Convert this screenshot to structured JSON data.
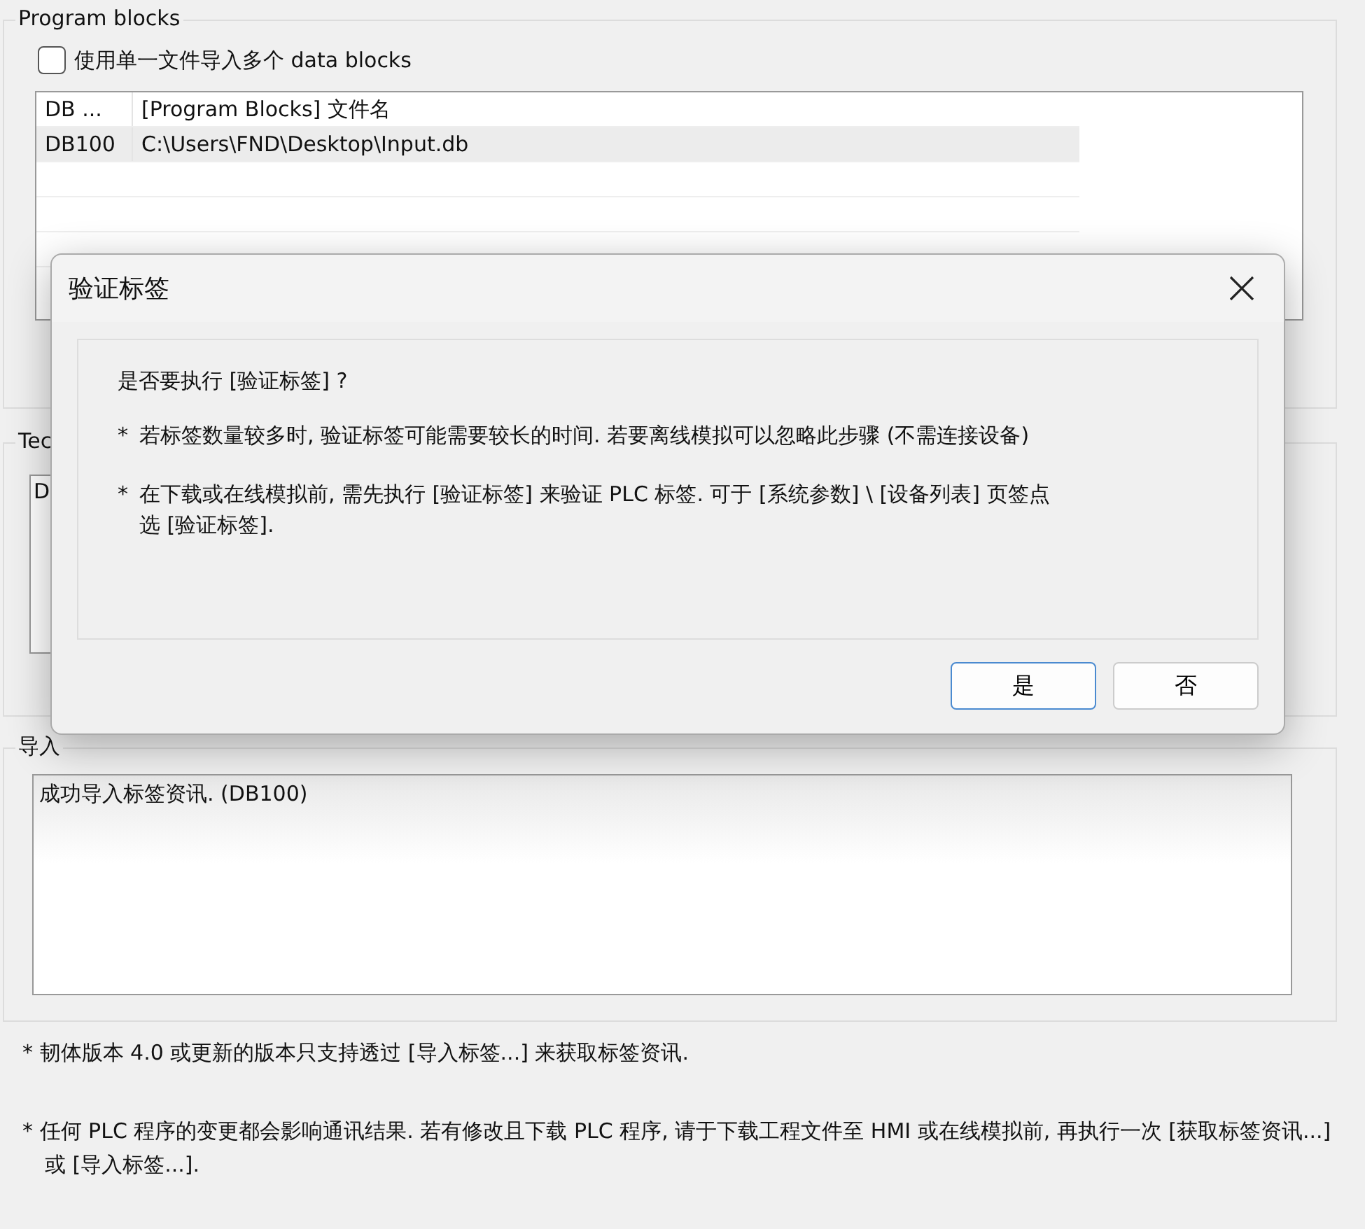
{
  "program_blocks": {
    "title": "Program blocks",
    "single_file": {
      "label": "使用单一文件导入多个 data blocks",
      "checked": false
    },
    "table": {
      "columns": [
        "DB ...",
        "[Program Blocks] 文件名"
      ],
      "rows": [
        {
          "cells": [
            "DB100",
            "C:\\Users\\FND\\Desktop\\Input.db"
          ],
          "selected": true
        }
      ]
    }
  },
  "tag_group": {
    "title": "Tec",
    "list_first": "D"
  },
  "import_group": {
    "title": "导入",
    "log": "成功导入标签资讯. (DB100)"
  },
  "notes": [
    "* 韧体版本 4.0 或更新的版本只支持透过 [导入标签...] 来获取标签资讯.",
    "* 任何 PLC 程序的变更都会影响通讯结果. 若有修改且下载 PLC 程序, 请于下载工程文件至 HMI 或在线模拟前, 再执行一次 [获取标签资讯...] 或 [导入标签...]."
  ],
  "dialog": {
    "title": "验证标签",
    "question": "是否要执行 [验证标签] ?",
    "bullets": [
      "若标签数量较多时, 验证标签可能需要较长的时间. 若要离线模拟可以忽略此步骤 (不需连接设备)",
      "在下载或在线模拟前, 需先执行 [验证标签] 来验证 PLC 标签. 可于 [系统参数] \\ [设备列表] 页签点选 [验证标签]."
    ],
    "bullet_mark": "*",
    "buttons": [
      {
        "label": "是",
        "selected": true
      },
      {
        "label": "否",
        "selected": false
      }
    ]
  }
}
